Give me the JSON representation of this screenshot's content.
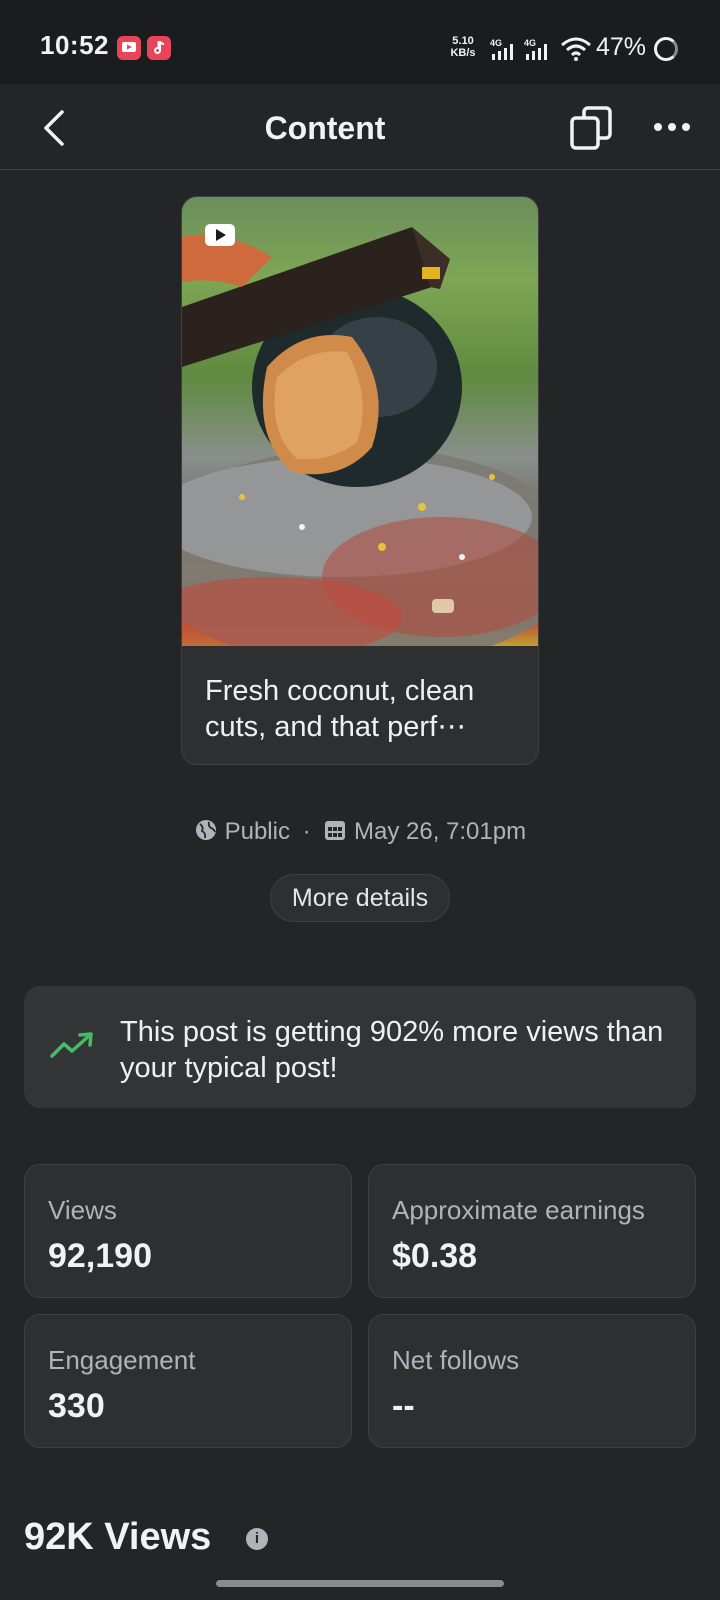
{
  "status_bar": {
    "time": "10:52",
    "net_speed_value": "5.10",
    "net_speed_unit": "KB/s",
    "signal_1_label": "4G",
    "signal_2_label": "4G",
    "battery": "47%",
    "icons": [
      "video-app-notification-icon",
      "music-app-notification-icon",
      "wifi-icon",
      "battery-icon"
    ]
  },
  "header": {
    "title": "Content"
  },
  "post": {
    "caption": "Fresh coconut, clean cuts, and that perf⋯",
    "media_type_icon": "video-play-icon"
  },
  "meta": {
    "visibility": "Public",
    "separator": "·",
    "date": "May 26, 7:01pm"
  },
  "more_details_label": "More details",
  "insight": {
    "text": "This post is getting 902% more views than your typical post!",
    "icon": "trending-up-icon",
    "accent_color": "#45bd62"
  },
  "stats": [
    {
      "label": "Views",
      "value": "92,190"
    },
    {
      "label": "Approximate earnings",
      "value": "$0.38"
    },
    {
      "label": "Engagement",
      "value": "330"
    },
    {
      "label": "Net follows",
      "value": "--"
    }
  ],
  "section": {
    "title": "92K Views",
    "info_glyph": "i"
  }
}
